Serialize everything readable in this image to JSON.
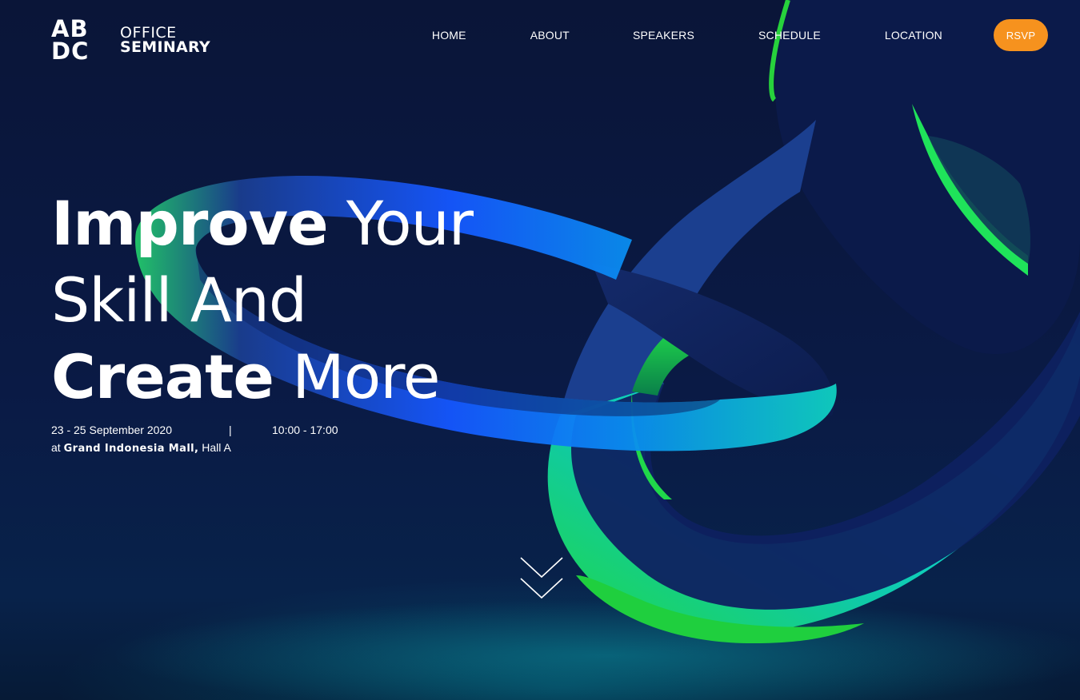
{
  "logo": {
    "mark_row1": "AB",
    "mark_row2": "DC",
    "line1": "OFFICE",
    "line2": "SEMINARY"
  },
  "nav": {
    "items": [
      "HOME",
      "ABOUT",
      "SPEAKERS",
      "SCHEDULE",
      "LOCATION"
    ],
    "rsvp_label": "RSVP"
  },
  "hero": {
    "line1_bold": "Improve",
    "line1_light": " Your",
    "line2_light": "Skill And",
    "line3_bold": "Create",
    "line3_light": " More"
  },
  "event": {
    "date": "23 - 25 September 2020",
    "separator": "|",
    "time": "10:00 - 17:00",
    "at": "at",
    "venue": "Grand Indonesia Mall,",
    "hall": "Hall A"
  },
  "colors": {
    "background": "#0a1538",
    "accent": "#f6921e",
    "ribbon_green": "#27e04a",
    "ribbon_blue": "#1560ff",
    "ribbon_cyan": "#0fd8e0"
  },
  "icons": {
    "scroll_down": "double-chevron-down-icon"
  }
}
